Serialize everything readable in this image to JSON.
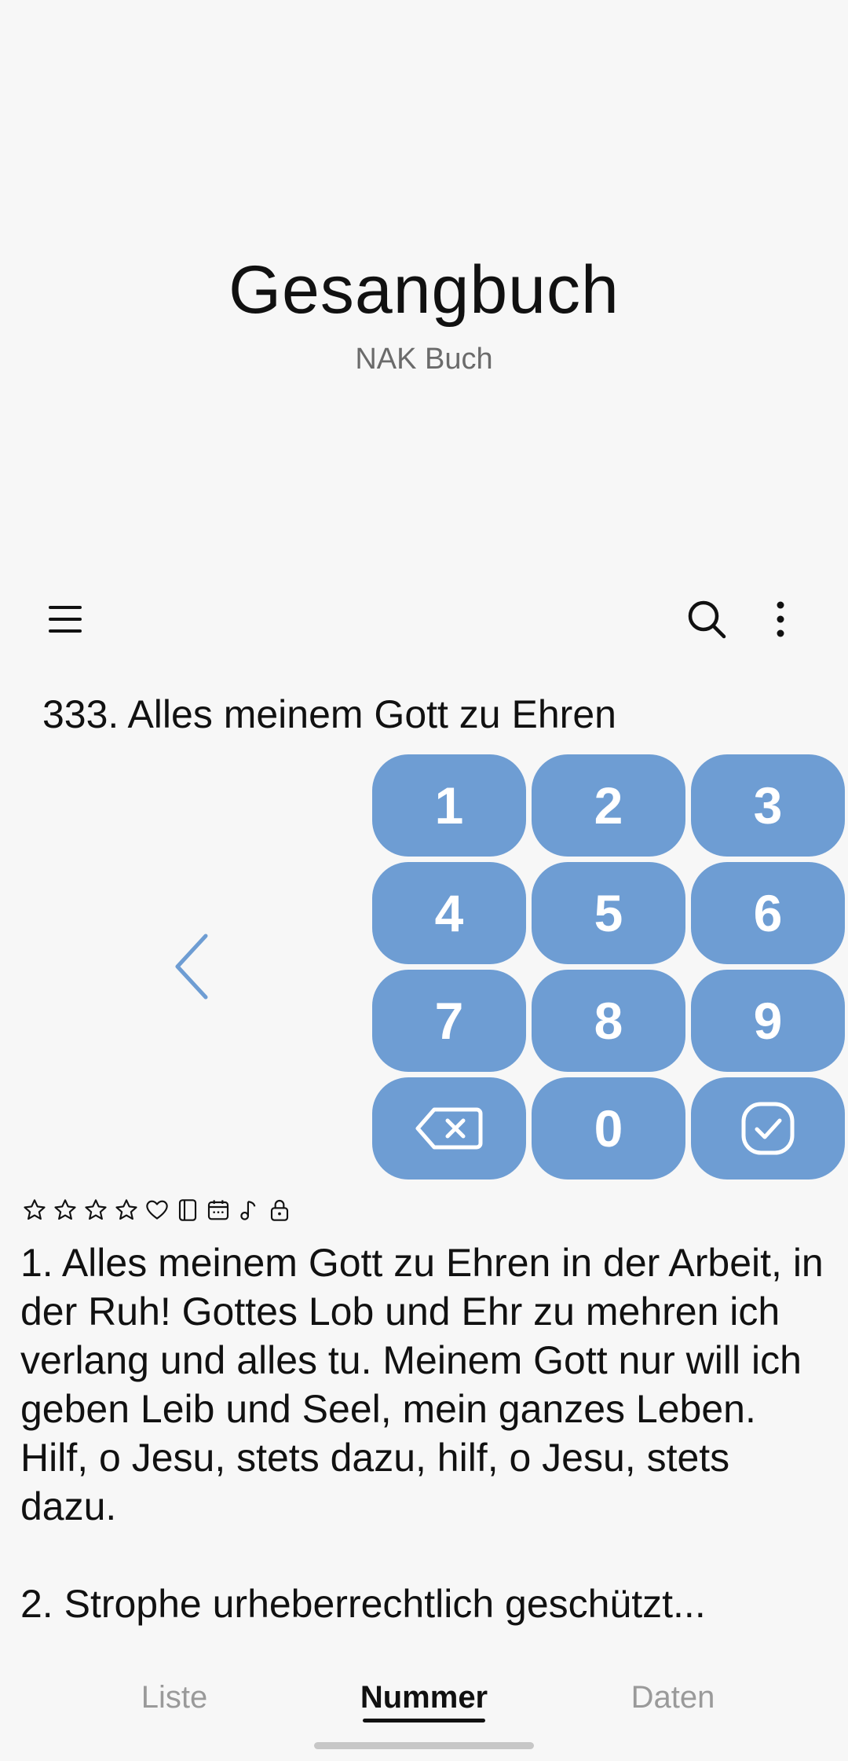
{
  "header": {
    "title": "Gesangbuch",
    "subtitle": "NAK Buch"
  },
  "toolbar": {
    "menu_icon": "hamburger-menu-icon",
    "search_icon": "search-icon",
    "more_icon": "more-vertical-icon"
  },
  "hymn": {
    "title": "333. Alles meinem Gott zu Ehren"
  },
  "keypad": {
    "keys": [
      "1",
      "2",
      "3",
      "4",
      "5",
      "6",
      "7",
      "8",
      "9",
      "backspace",
      "0",
      "confirm"
    ],
    "key_color": "#6e9dd3"
  },
  "status_icons": [
    "star-icon",
    "star-icon",
    "star-icon",
    "star-icon",
    "heart-icon",
    "bookmark-icon",
    "calendar-icon",
    "music-note-icon",
    "lock-icon"
  ],
  "lyrics": {
    "verse1": "1. Alles meinem Gott zu Ehren in der Arbeit, in der Ruh! Gottes Lob und Ehr zu mehren ich verlang und alles tu. Meinem Gott nur will ich geben Leib und Seel, mein ganzes Leben. Hilf, o Jesu, stets dazu, hilf, o Jesu, stets dazu.",
    "verse2": "2. Strophe urheberrechtlich geschützt..."
  },
  "tabs": {
    "liste": "Liste",
    "nummer": "Nummer",
    "daten": "Daten",
    "active": "Nummer"
  }
}
